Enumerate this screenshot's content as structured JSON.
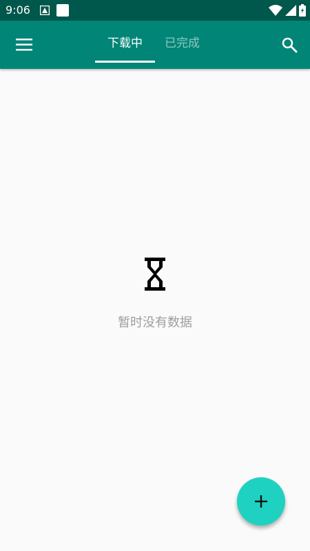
{
  "status_bar": {
    "time": "9:06",
    "icons": [
      "notification-a-icon",
      "notification-square-icon",
      "wifi-icon",
      "signal-icon",
      "battery-icon"
    ]
  },
  "app_bar": {
    "menu_icon": "hamburger-menu-icon",
    "search_icon": "search-icon",
    "tabs": [
      {
        "label": "下载中",
        "active": true
      },
      {
        "label": "已完成",
        "active": false
      }
    ]
  },
  "empty_state": {
    "icon": "hourglass-icon",
    "text": "暂时没有数据"
  },
  "fab": {
    "icon": "plus-icon"
  },
  "colors": {
    "status_bar": "#00574b",
    "app_bar": "#008577",
    "fab": "#1fd1c1",
    "background": "#fafafa",
    "empty_text": "#9e9e9e"
  }
}
